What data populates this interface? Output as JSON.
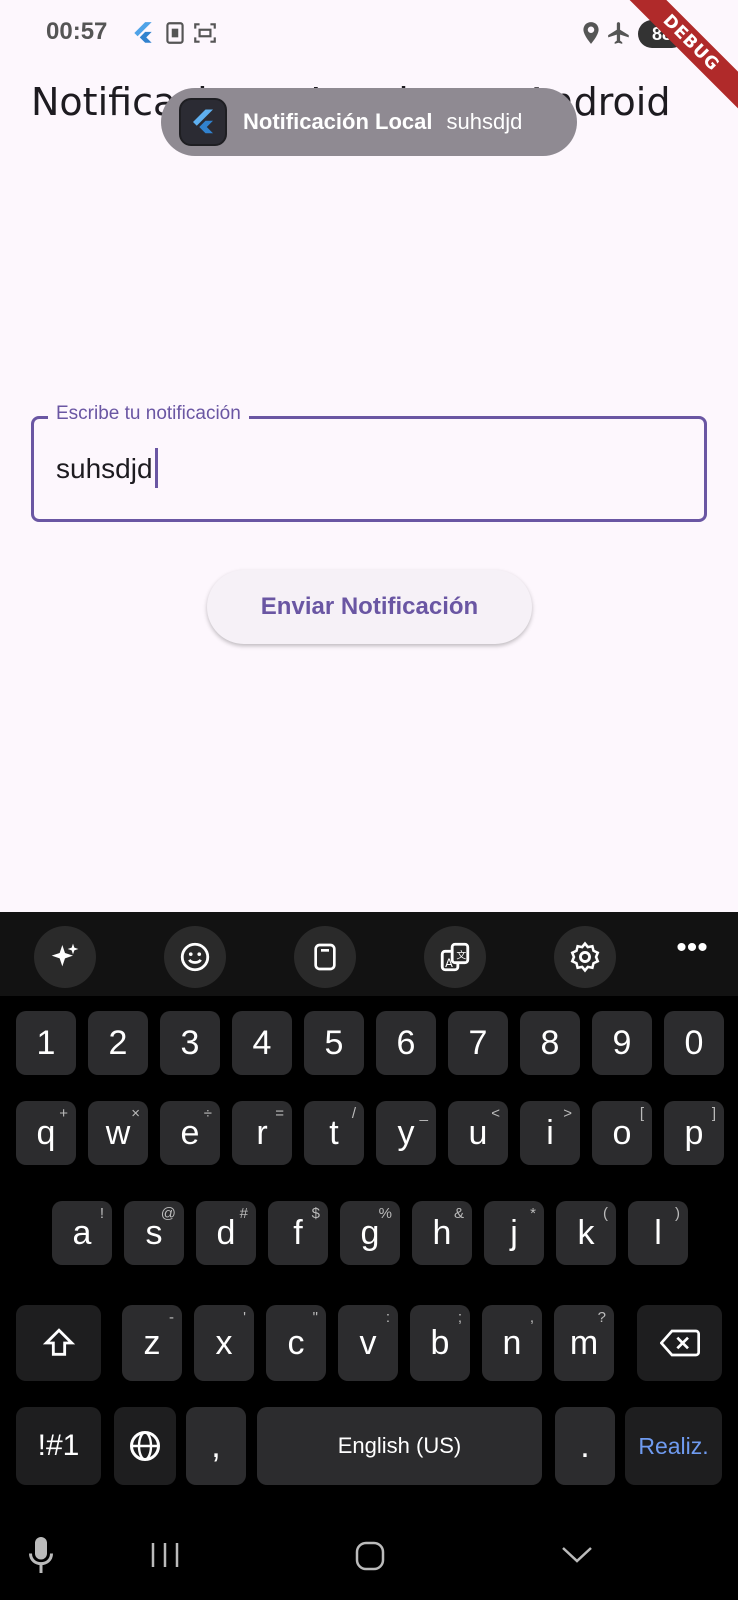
{
  "status_bar": {
    "time": "00:57",
    "left_icons": [
      "flutter-icon",
      "sim-card-icon",
      "screenshot-icon"
    ],
    "right_icons": [
      "location-icon",
      "airplane-icon",
      "battery-charging-icon"
    ],
    "battery_text": "88",
    "debug_banner": "DEBUG"
  },
  "app": {
    "title": "Notificaciones Locales en Android"
  },
  "notification": {
    "app_icon": "flutter-icon",
    "title": "Notificación Local",
    "body": "suhsdjd"
  },
  "form": {
    "field_label": "Escribe tu notificación",
    "field_value": "suhsdjd",
    "send_button": "Enviar Notificación",
    "accent_color": "#6a56a3"
  },
  "keyboard": {
    "toolbar": [
      "sparkle-icon",
      "emoji-icon",
      "clipboard-icon",
      "translate-icon",
      "settings-icon",
      "more-icon"
    ],
    "number_row": [
      "1",
      "2",
      "3",
      "4",
      "5",
      "6",
      "7",
      "8",
      "9",
      "0"
    ],
    "row1": [
      {
        "k": "q",
        "s": "+"
      },
      {
        "k": "w",
        "s": "×"
      },
      {
        "k": "e",
        "s": "÷"
      },
      {
        "k": "r",
        "s": "="
      },
      {
        "k": "t",
        "s": "/"
      },
      {
        "k": "y",
        "s": "_"
      },
      {
        "k": "u",
        "s": "<"
      },
      {
        "k": "i",
        "s": ">"
      },
      {
        "k": "o",
        "s": "["
      },
      {
        "k": "p",
        "s": "]"
      }
    ],
    "row2": [
      {
        "k": "a",
        "s": "!"
      },
      {
        "k": "s",
        "s": "@"
      },
      {
        "k": "d",
        "s": "#"
      },
      {
        "k": "f",
        "s": "$"
      },
      {
        "k": "g",
        "s": "%"
      },
      {
        "k": "h",
        "s": "&"
      },
      {
        "k": "j",
        "s": "*"
      },
      {
        "k": "k",
        "s": "("
      },
      {
        "k": "l",
        "s": ")"
      }
    ],
    "row3": [
      {
        "k": "z",
        "s": "-"
      },
      {
        "k": "x",
        "s": "'"
      },
      {
        "k": "c",
        "s": "\""
      },
      {
        "k": "v",
        "s": ":"
      },
      {
        "k": "b",
        "s": ";"
      },
      {
        "k": "n",
        "s": ","
      },
      {
        "k": "m",
        "s": "?"
      }
    ],
    "symbols_key": "!#1",
    "comma_key": ",",
    "space_label": "English (US)",
    "period_key": ".",
    "done_label": "Realiz."
  },
  "nav_bar": {
    "icons": [
      "microphone-icon",
      "recents-icon",
      "home-icon",
      "back-icon"
    ]
  }
}
